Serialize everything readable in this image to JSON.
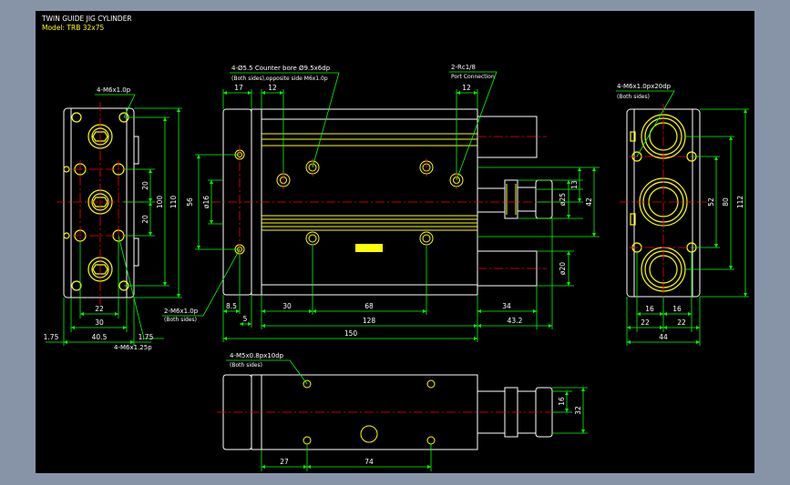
{
  "title": {
    "line1": "TWIN GUIDE JIG CYLINDER",
    "line2": "Model: TRB 32x75"
  },
  "colors": {
    "background": "#000000",
    "outline": "#ffffff",
    "dimension": "#00ff00",
    "yellow": "#ffff00",
    "centerline": "#ff0000",
    "frame": "#8794a8"
  },
  "annotations": {
    "left_top_thread": "4-M6x1.0p",
    "left_bottom_thread": "4-M6x1.25p",
    "side_thread": "2-M6x1.0p",
    "side_thread_note": "(Both sides)",
    "counterbore": "4-Ø5.5  Counter bore Ø9.5x6dp",
    "counterbore_note": "(Both sides),opposite side M6x1.0p",
    "port": "2-Rc1/8",
    "port_note": "Port Connection",
    "right_thread": "4-M6x1.0px20dp",
    "right_thread_note": "(Both sides)",
    "bottom_thread": "4-M5x0.8px10dp",
    "bottom_thread_note": "(Both sides)"
  },
  "dims": {
    "d22": "22",
    "d30": "30",
    "d40_5": "40.5",
    "d1_75a": "1.75",
    "d1_75b": "1.75",
    "d20a": "20",
    "d20b": "20",
    "d100": "100",
    "d110": "110",
    "d17": "17",
    "d12a": "12",
    "d12b": "12",
    "d56": "56",
    "p16": "ø16",
    "d8_5": "8.5",
    "d5": "5",
    "d30b": "30",
    "d68": "68",
    "d128": "128",
    "d150": "150",
    "d34": "34",
    "d43_2": "43.2",
    "p25": "ø25",
    "d13": "13",
    "d42": "42",
    "p20": "ø20",
    "d16a": "16",
    "d16b": "16",
    "d22a": "22",
    "d22b": "22",
    "d44": "44",
    "d52": "52",
    "d80": "80",
    "d112": "112",
    "d27": "27",
    "d74": "74",
    "d16c": "16",
    "d32": "32"
  }
}
